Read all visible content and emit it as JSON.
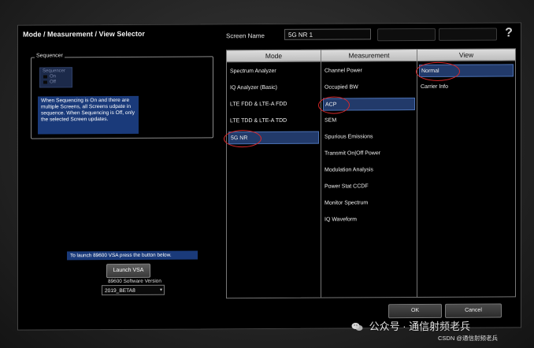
{
  "dialog": {
    "title": "Mode / Measurement / View Selector",
    "screen_name_label": "Screen Name",
    "screen_name_value": "5G NR 1",
    "help_label": "?"
  },
  "sequencer": {
    "label": "Sequencer",
    "options": [
      "On",
      "Off"
    ],
    "selected": "Off",
    "info": "When Sequencing is On and there are multiple Screens, all Screens udpate in sequence. When Sequencing is Off, only the selected Screen updates."
  },
  "vsa": {
    "info": "To launch 89600 VSA press the button below.",
    "launch_label": "Launch VSA",
    "software_version_label": "89600 Software Version",
    "software_version_value": "2019_BETA8",
    "dropdown_arrow": "▾"
  },
  "columns": {
    "mode": {
      "header": "Mode",
      "items": [
        "Spectrum Analyzer",
        "IQ Analyzer (Basic)",
        "LTE FDD & LTE-A FDD",
        "LTE TDD & LTE-A TDD",
        "5G NR"
      ],
      "selected_index": 4
    },
    "measurement": {
      "header": "Measurement",
      "items": [
        "Channel Power",
        "Occupied BW",
        "ACP",
        "SEM",
        "Spurious Emissions",
        "Transmit On|Off Power",
        "Modulation Analysis",
        "Power Stat CCDF",
        "Monitor Spectrum",
        "IQ Waveform"
      ],
      "selected_index": 2
    },
    "view": {
      "header": "View",
      "items": [
        "Normal",
        "Carrier Info"
      ],
      "selected_index": 0
    }
  },
  "buttons": {
    "ok": "OK",
    "cancel": "Cancel"
  },
  "watermark": {
    "main": "公众号 · 通信射频老兵",
    "sub": "CSDN @通信射频老兵"
  },
  "colors": {
    "selection": "#223a6a",
    "info_box": "#1a3a7a",
    "annotation_circle": "#d8282a"
  }
}
